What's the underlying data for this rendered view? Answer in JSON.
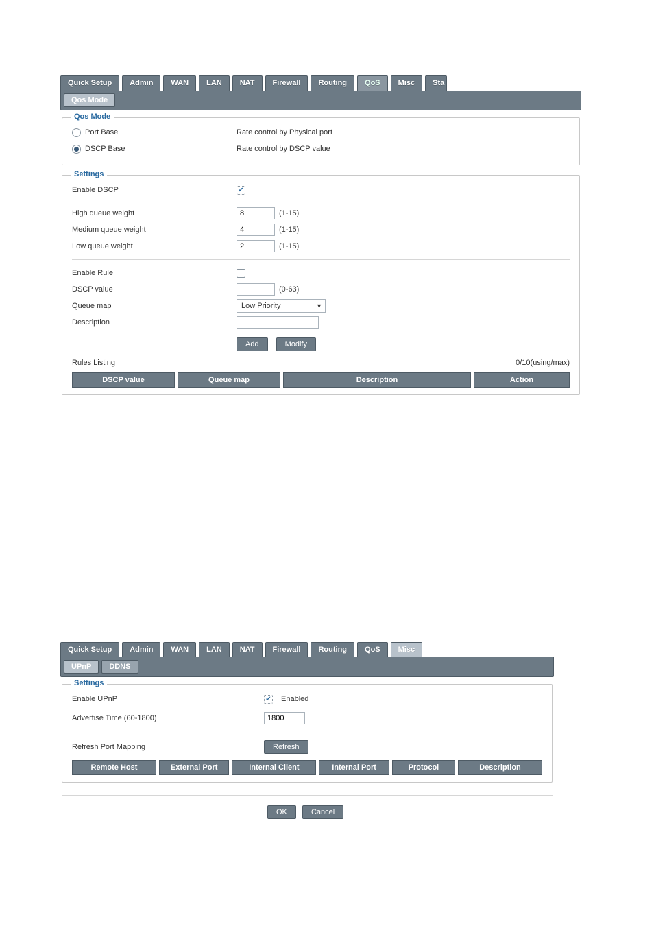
{
  "qos": {
    "tabs": [
      "Quick Setup",
      "Admin",
      "WAN",
      "LAN",
      "NAT",
      "Firewall",
      "Routing",
      "QoS",
      "Misc",
      "Sta"
    ],
    "active_tab": "QoS",
    "subtabs": [
      "Qos Mode"
    ],
    "active_subtab": "Qos Mode",
    "mode_group": {
      "legend": "Qos Mode",
      "options": [
        {
          "label": "Port Base",
          "desc": "Rate control by Physical port",
          "selected": false
        },
        {
          "label": "DSCP Base",
          "desc": "Rate control by DSCP value",
          "selected": true
        }
      ]
    },
    "settings_group": {
      "legend": "Settings",
      "enable_dscp": {
        "label": "Enable DSCP",
        "checked": true
      },
      "weights": [
        {
          "label": "High queue weight",
          "value": "8",
          "hint": "(1-15)"
        },
        {
          "label": "Medium queue weight",
          "value": "4",
          "hint": "(1-15)"
        },
        {
          "label": "Low queue weight",
          "value": "2",
          "hint": "(1-15)"
        }
      ],
      "enable_rule": {
        "label": "Enable Rule",
        "checked": false
      },
      "dscp_value": {
        "label": "DSCP value",
        "value": "",
        "hint": "(0-63)"
      },
      "queue_map": {
        "label": "Queue map",
        "selected": "Low Priority"
      },
      "description": {
        "label": "Description",
        "value": ""
      },
      "buttons": {
        "add": "Add",
        "modify": "Modify"
      },
      "rules_listing_label": "Rules Listing",
      "rules_count": "0/10(using/max)",
      "table_headers": [
        "DSCP value",
        "Queue map",
        "Description",
        "Action"
      ]
    }
  },
  "misc": {
    "tabs": [
      "Quick Setup",
      "Admin",
      "WAN",
      "LAN",
      "NAT",
      "Firewall",
      "Routing",
      "QoS",
      "Misc"
    ],
    "active_tab": "Misc",
    "subtabs": [
      "UPnP",
      "DDNS"
    ],
    "active_subtab": "UPnP",
    "settings_group": {
      "legend": "Settings",
      "enable_upnp": {
        "label": "Enable UPnP",
        "checked": true,
        "checkbox_label": "Enabled"
      },
      "advertise": {
        "label": "Advertise Time (60-1800)",
        "value": "1800"
      },
      "refresh_label": "Refresh Port Mapping",
      "refresh_button": "Refresh",
      "table_headers": [
        "Remote Host",
        "External Port",
        "Internal Client",
        "Internal Port",
        "Protocol",
        "Description"
      ]
    },
    "ok_label": "OK",
    "cancel_label": "Cancel"
  }
}
